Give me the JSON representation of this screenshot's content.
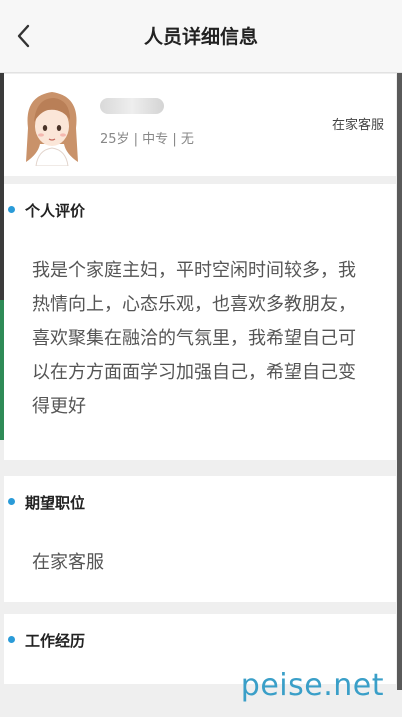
{
  "header": {
    "back_icon": "chevron-left-icon",
    "title": "人员详细信息"
  },
  "profile": {
    "meta": "25岁 | 中专 | 无",
    "job": "在家客服"
  },
  "evaluation": {
    "heading": "个人评价",
    "text": "我是个家庭主妇，平时空闲时间较多，我热情向上，心态乐观，也喜欢多教朋友，喜欢聚集在融洽的气氛里，我希望自己可以在方方面面学习加强自己，希望自己变得更好"
  },
  "position": {
    "heading": "期望职位",
    "text": "在家客服"
  },
  "experience": {
    "heading": "工作经历"
  },
  "watermark": "peise.net",
  "colors": {
    "accent_dot": "#2a9bd8",
    "watermark": "#3a9fc8"
  }
}
